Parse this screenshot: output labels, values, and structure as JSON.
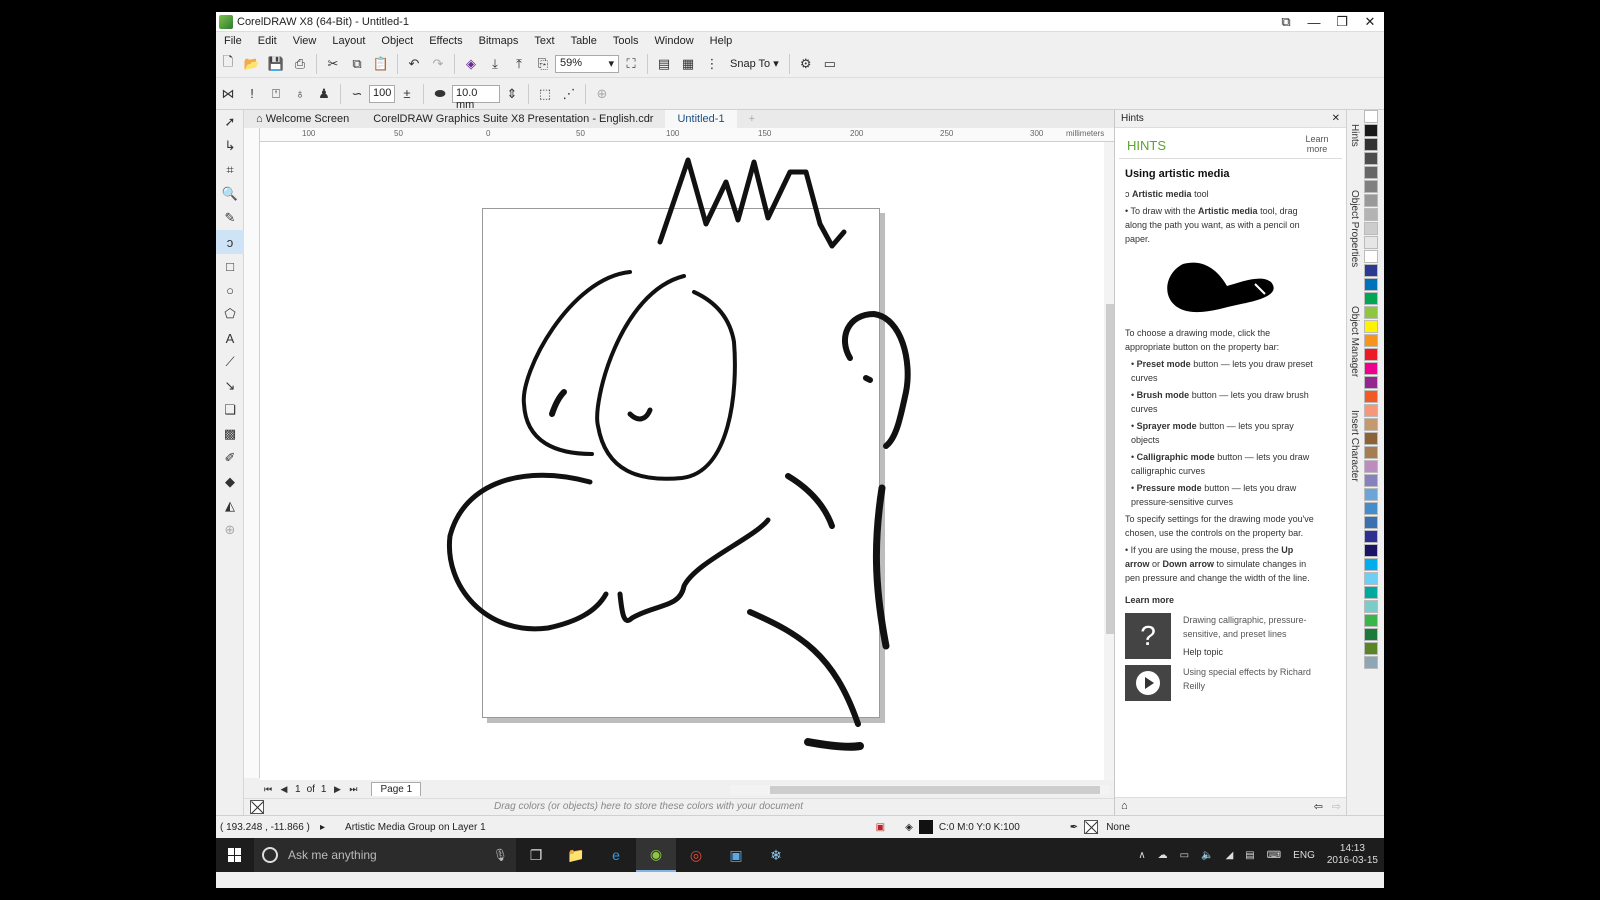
{
  "window": {
    "title": "CorelDRAW X8 (64-Bit) - Untitled-1",
    "controls": [
      "⧉",
      "—",
      "❐",
      "✕"
    ]
  },
  "menu": [
    "File",
    "Edit",
    "View",
    "Layout",
    "Object",
    "Effects",
    "Bitmaps",
    "Text",
    "Table",
    "Tools",
    "Window",
    "Help"
  ],
  "toolbar": {
    "zoom": "59%",
    "snap_label": "Snap To",
    "smoothing": "100",
    "stroke_width": "10.0 mm"
  },
  "doc_tabs": [
    {
      "label": "Welcome Screen",
      "icon": "home-icon"
    },
    {
      "label": "CorelDRAW Graphics Suite X8 Presentation - English.cdr"
    },
    {
      "label": "Untitled-1",
      "active": true
    }
  ],
  "ruler": {
    "unit": "millimeters",
    "ticks": [
      "100",
      "50",
      "0",
      "50",
      "100",
      "150",
      "200",
      "250",
      "300"
    ]
  },
  "page_nav": {
    "current": "1",
    "of_label": "of",
    "total": "1",
    "page_tab": "Page 1"
  },
  "color_strip": {
    "message": "Drag colors (or objects) here to store these colors with your document"
  },
  "status": {
    "coords": "( 193.248 , -11.866 )",
    "selection": "Artistic Media Group on Layer 1",
    "fill": "C:0 M:0 Y:0 K:100",
    "outline": "None"
  },
  "hints": {
    "panel_title": "Hints",
    "heading": "HINTS",
    "learn_more_short": "Learn more",
    "topic": "Using artistic media",
    "tool_name": "Artistic media",
    "tool_suffix": "tool",
    "p1_pre": "To draw with the ",
    "p1_bold": "Artistic media",
    "p1_post": " tool, drag along the path you want, as with a pencil on paper.",
    "p2": "To choose a drawing mode, click the appropriate button on the property bar:",
    "modes": [
      {
        "name": "Preset mode",
        "text": "button — lets you draw preset curves"
      },
      {
        "name": "Brush mode",
        "text": "button — lets you draw brush curves"
      },
      {
        "name": "Sprayer mode",
        "text": "button — lets you spray objects"
      },
      {
        "name": "Calligraphic mode",
        "text": "button — lets you draw calligraphic curves"
      },
      {
        "name": "Pressure mode",
        "text": "button — lets you draw pressure-sensitive curves"
      }
    ],
    "p3": "To specify settings for the drawing mode you've chosen, use the controls on the property bar.",
    "p4_pre": "If you are using the mouse, press the ",
    "p4_up": "Up arrow",
    "p4_mid": " or ",
    "p4_down": "Down arrow",
    "p4_post": " to simulate changes in pen pressure and change the width of the line.",
    "learn_more": "Learn more",
    "link1": "Drawing calligraphic, pressure-sensitive, and preset lines",
    "link1_sub": "Help topic",
    "link2": "Using special effects by Richard Reilly"
  },
  "docker_tabs": [
    "Hints",
    "Object Properties",
    "Object Manager",
    "Insert Character"
  ],
  "palette": [
    "#ffffff",
    "#1a1a1a",
    "#333333",
    "#4d4d4d",
    "#666666",
    "#808080",
    "#999999",
    "#b3b3b3",
    "#cccccc",
    "#e6e6e6",
    "#ffffff",
    "#2b3990",
    "#0072bc",
    "#00a651",
    "#8dc63f",
    "#fff200",
    "#f7941d",
    "#ed1c24",
    "#ec008c",
    "#92278f",
    "#f15a24",
    "#f7977a",
    "#c49a6c",
    "#8c6239",
    "#a67c52",
    "#bd8cbf",
    "#8781bd",
    "#6ea5d8",
    "#448ccb",
    "#3a6fb0",
    "#2e3192",
    "#1b1464",
    "#00aeef",
    "#6dcff6",
    "#00a99d",
    "#7accc8",
    "#39b54a",
    "#1e7a3a",
    "#598527",
    "#8ca6b4"
  ],
  "taskbar": {
    "search_placeholder": "Ask me anything",
    "lang": "ENG",
    "time": "14:13",
    "date": "2016-03-15"
  }
}
